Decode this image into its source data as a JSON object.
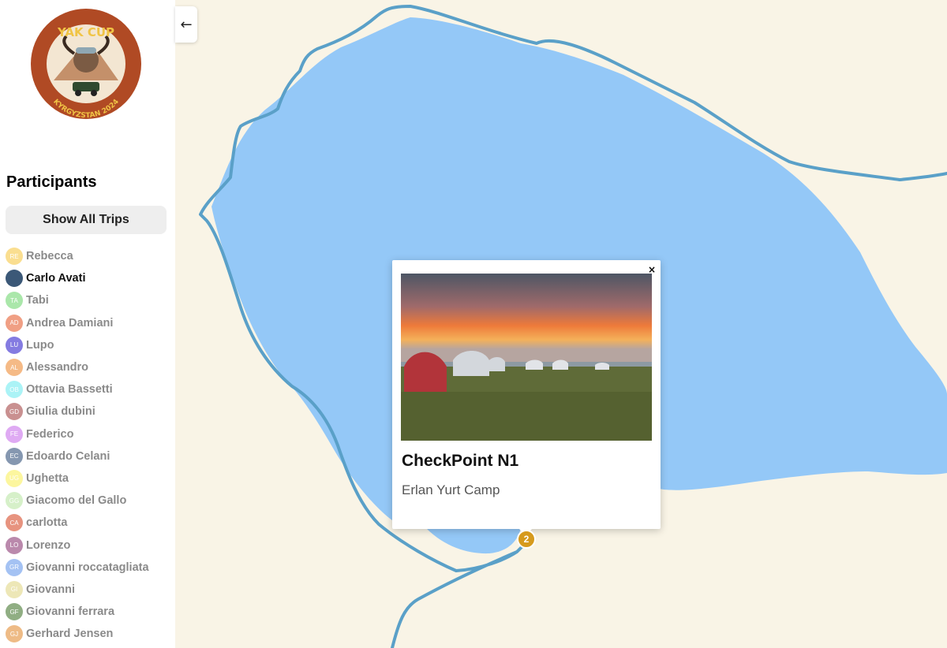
{
  "logo": {
    "top_text": "YAK CUP",
    "bottom_text": "KYRGYZSTAN 2024"
  },
  "sidebar": {
    "title": "Participants",
    "show_all_label": "Show All Trips",
    "participants": [
      {
        "name": "Rebecca",
        "initials": "RE",
        "color": "#f9d46b",
        "active": false
      },
      {
        "name": "Carlo Avati",
        "initials": "",
        "color": "#3b5877",
        "active": true
      },
      {
        "name": "Tabi",
        "initials": "TA",
        "color": "#8ee08e",
        "active": false
      },
      {
        "name": "Andrea Damiani",
        "initials": "AD",
        "color": "#ec7f5b",
        "active": false
      },
      {
        "name": "Lupo",
        "initials": "LU",
        "color": "#5b4fd8",
        "active": false
      },
      {
        "name": "Alessandro",
        "initials": "AL",
        "color": "#f2a45e",
        "active": false
      },
      {
        "name": "Ottavia Bassetti",
        "initials": "OB",
        "color": "#8ff0f4",
        "active": false
      },
      {
        "name": "Giulia dubini",
        "initials": "GD",
        "color": "#b86c6c",
        "active": false
      },
      {
        "name": "Federico",
        "initials": "FE",
        "color": "#d58ef0",
        "active": false
      },
      {
        "name": "Edoardo Celani",
        "initials": "EC",
        "color": "#5d7596",
        "active": false
      },
      {
        "name": "Ughetta",
        "initials": "UG",
        "color": "#fbf37e",
        "active": false
      },
      {
        "name": "Giacomo del Gallo",
        "initials": "GG",
        "color": "#c9ecb7",
        "active": false
      },
      {
        "name": "carlotta",
        "initials": "CA",
        "color": "#e06f55",
        "active": false
      },
      {
        "name": "Lorenzo",
        "initials": "LO",
        "color": "#a36291",
        "active": false
      },
      {
        "name": "Giovanni roccatagliata",
        "initials": "GR",
        "color": "#86aef0",
        "active": false
      },
      {
        "name": "Giovanni",
        "initials": "GI",
        "color": "#e7dfa0",
        "active": false
      },
      {
        "name": "Giovanni ferrara",
        "initials": "GF",
        "color": "#6b935a",
        "active": false
      },
      {
        "name": "Gerhard Jensen",
        "initials": "GJ",
        "color": "#e9a55e",
        "active": false
      }
    ]
  },
  "collapse_button": "←",
  "map": {
    "water_color": "#94c8f7",
    "land_color": "#f9f4e6",
    "route_color": "#5aa0c8"
  },
  "popup": {
    "title": "CheckPoint N1",
    "subtitle": "Erlan Yurt Camp",
    "close": "×"
  },
  "marker": {
    "label": "2",
    "color": "#d69a1d"
  }
}
